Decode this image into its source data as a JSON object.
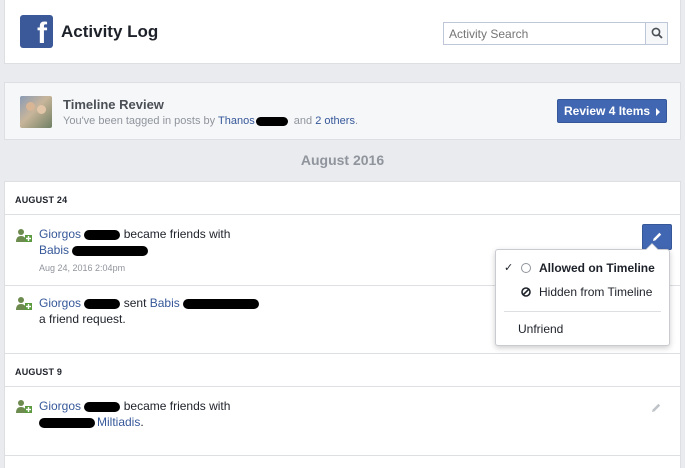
{
  "header": {
    "logo_letter": "f",
    "title": "Activity Log",
    "search_placeholder": "Activity Search"
  },
  "review": {
    "title": "Timeline Review",
    "sub_prefix": "You've been tagged in posts by",
    "tagger_name": "Thanos",
    "sub_and": "and",
    "others_link": "2 others",
    "period": ".",
    "button_label": "Review 4 Items"
  },
  "month_label": "August 2016",
  "days": [
    {
      "label": "AUGUST 24",
      "entries": [
        {
          "actor": "Giorgos",
          "verb": "became friends with",
          "target": "Babis",
          "time": "Aug 24, 2016 2:04pm"
        },
        {
          "actor": "Giorgos",
          "verb": "sent",
          "target": "Babis",
          "tail": "a friend request."
        }
      ]
    },
    {
      "label": "AUGUST 9",
      "entries": [
        {
          "actor": "Giorgos",
          "verb": "became friends with",
          "target": "Miltiadis",
          "period": "."
        }
      ]
    }
  ],
  "dropdown": {
    "check": "✓",
    "allowed": "Allowed on Timeline",
    "hidden": "Hidden from Timeline",
    "unfriend": "Unfriend"
  },
  "colors": {
    "brand": "#3b5998",
    "button": "#4267b2",
    "link": "#365899"
  }
}
